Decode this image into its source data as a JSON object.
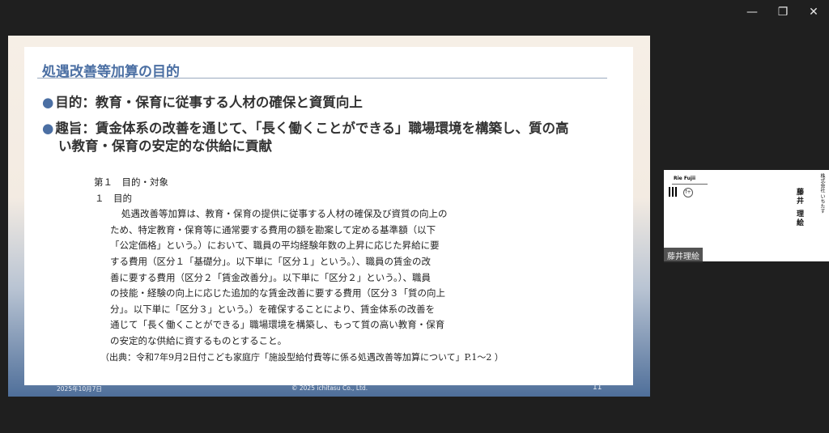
{
  "window": {
    "minimize": "—",
    "restore": "❐",
    "close": "✕"
  },
  "slide": {
    "title": "処遇改善等加算の目的",
    "bullet_char": "●",
    "bullet1": "目的：教育・保育に従事する人材の確保と資質向上",
    "bullet2_line1": "趣旨：賃金体系の改善を通じて、「長く働くことができる」職場環境を構築し、質の高",
    "bullet2_line2": "い教育・保育の安定的な供給に貢献",
    "doc_section": "第１　目的・対象",
    "doc_sub": "１　目的",
    "doc_lines": [
      "処遇改善等加算は、教育・保育の提供に従事する人材の確保及び資質の向上の",
      "ため、特定教育・保育等に通常要する費用の額を勘案して定める基準額（以下",
      "「公定価格」という。）において、職員の平均経験年数の上昇に応じた昇給に要",
      "する費用（区分１「基礎分」。以下単に「区分１」という。）、職員の賃金の改",
      "善に要する費用（区分２「賃金改善分」。以下単に「区分２」という。）、職員",
      "の技能・経験の向上に応じた追加的な賃金改善に要する費用（区分３「質の向上",
      "分」。以下単に「区分３」という。）を確保することにより、賃金体系の改善を",
      "通じて「長く働くことができる」職場環境を構築し、もって質の高い教育・保育",
      "の安定的な供給に資するものとすること。"
    ],
    "source": "（出典：令和7年9月2日付こども家庭庁「施設型給付費等に係る処遇改善等加算について」P.1〜2 ）",
    "footer_date": "2025年10月7日",
    "footer_copy": "© 2025 ichitasu Co., Ltd.",
    "page_number": "11"
  },
  "participant": {
    "card_name_en": "Rie Fujii",
    "card_company": "株式会社 いちたす",
    "card_name_jp": "藤井 理絵",
    "fb_icon_text": "f+",
    "label": "藤井理絵"
  }
}
